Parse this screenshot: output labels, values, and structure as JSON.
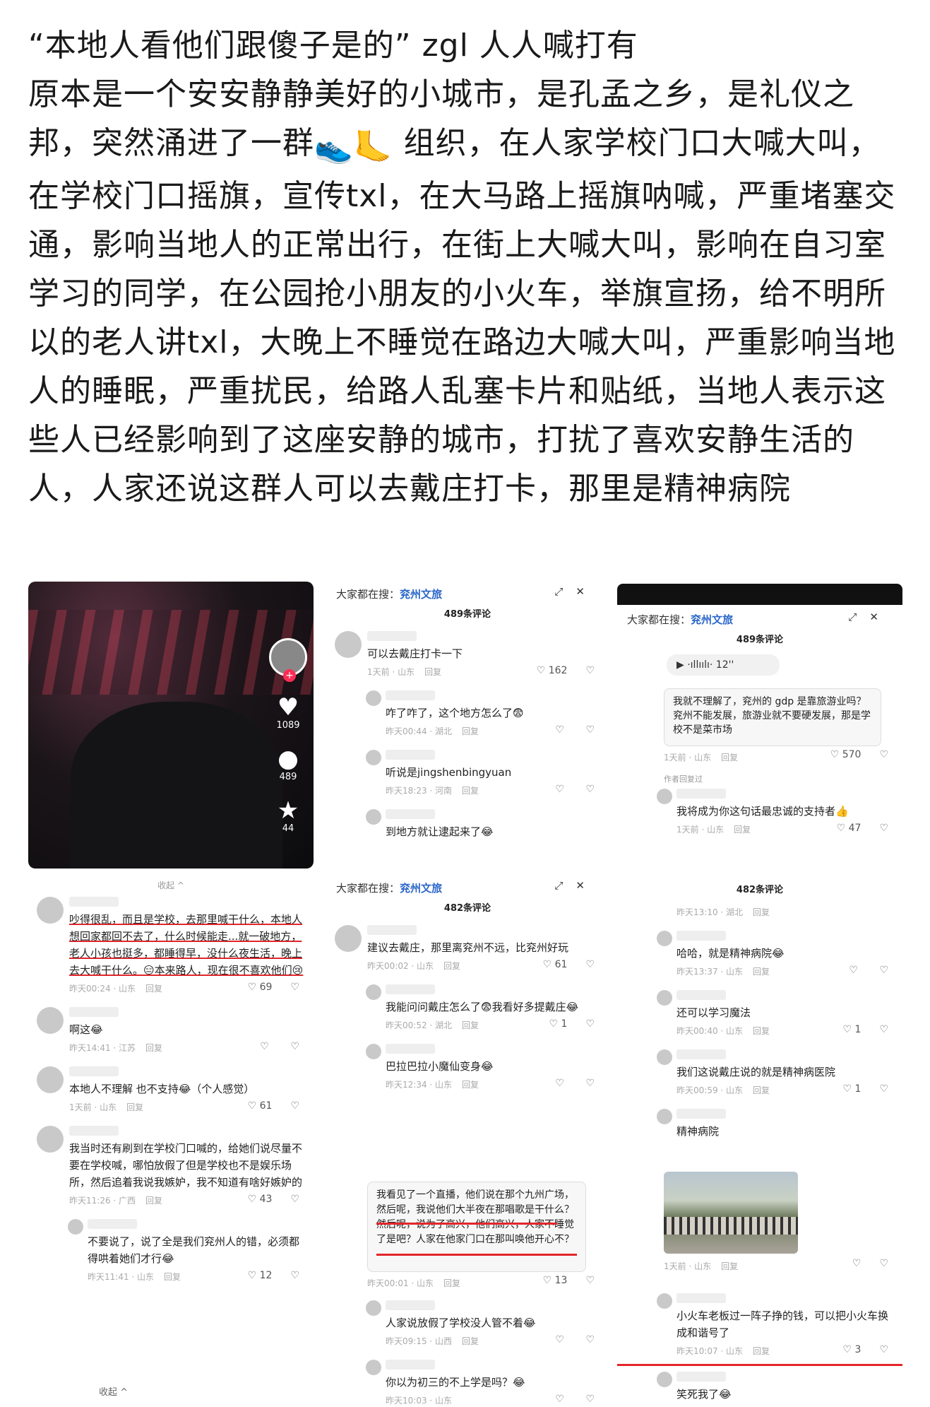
{
  "post": {
    "text": "“本地人看他们跟傻子是的” zgl 人人喊打有\n原本是一个安安静静美好的小城市，是孔孟之乡，是礼仪之邦，突然涌进了一群",
    "emoji_1": "👟",
    "emoji_2": "🦶",
    "text_2": "组织，在人家学校门口大喊大叫，在学校门口摇旗，宣传txl，在大马路上摇旗呐喊，严重堵塞交通，影响当地人的正常出行，在街上大喊大叫，影响在自习室学习的同学，在公园抢小朋友的小火车，举旗宣扬，给不明所以的老人讲txl，大晚上不睡觉在路边大喊大叫，严重影响当地人的睡眠，严重扰民，给路人乱塞卡片和贴纸，当地人表示这些人已经影响到了这座安静的城市，打扰了喜欢安静生活的人，人家还说这群人可以去戴庄打卡，那里是精神病院"
  },
  "video": {
    "likes": "1089",
    "comments": "489",
    "favorites": "44"
  },
  "search_header": {
    "prefix": "大家都在搜：",
    "query": "兖州文旅",
    "expand_icon": "expand-icon",
    "close_icon": "close-icon"
  },
  "panel_b": {
    "count": "489条评论",
    "comments": [
      {
        "text": "可以去戴庄打卡一下",
        "time": "1天前 · 山东",
        "reply": "回复",
        "likes": "162",
        "sub": false
      },
      {
        "text": "咋了咋了，这个地方怎么了😨",
        "time": "昨天00:44 · 湖北",
        "reply": "回复",
        "likes": "",
        "sub": true
      },
      {
        "text": "听说是jingshenbingyuan",
        "time": "昨天18:23 · 河南",
        "reply": "回复",
        "likes": "",
        "sub": true
      },
      {
        "text": "到地方就让逮起来了😂",
        "time": "",
        "reply": "",
        "likes": "",
        "sub": true
      }
    ]
  },
  "panel_c": {
    "count": "489条评论",
    "voice": "12''",
    "bubble": "我就不理解了，兖州的 gdp 是靠旅游业吗？兖州不能发展，旅游业就不要硬发展，那是学校不是菜市场",
    "bubble_time": "1天前 · 山东",
    "bubble_reply": "回复",
    "bubble_likes": "570",
    "author_tag": "作者回复过",
    "comments": [
      {
        "text": "我将成为你这句话最忠诚的支持者👍",
        "time": "1天前 · 山东",
        "reply": "回复",
        "likes": "47",
        "sub": true
      }
    ]
  },
  "panel_d": {
    "collapse": "收起 ^",
    "comments": [
      {
        "text": "吵得很乱，而且是学校，去那里喊干什么，本地人想回家都回不去了，什么时候能走...就一破地方，老人小孩也挺多，都睡得早，没什么夜生活，晚上去大喊干什么。😑本来路人，现在很不喜欢他们😢",
        "time": "昨天00:24 · 山东",
        "reply": "回复",
        "likes": "69",
        "sub": false
      },
      {
        "text": "啊这😂",
        "time": "昨天14:41 · 江苏",
        "reply": "回复",
        "likes": "",
        "sub": false
      },
      {
        "text": "本地人不理解  也不支持😂（个人感觉）",
        "time": "1天前 · 山东",
        "reply": "回复",
        "likes": "61",
        "sub": false
      },
      {
        "text": "我当时还有刷到在学校门口喊的，给她们说尽量不要在学校喊，哪怕放假了但是学校也不是娱乐场所，然后追着我说我嫉妒，我不知道有啥好嫉妒的",
        "time": "昨天11:26 · 广西",
        "reply": "回复",
        "likes": "43",
        "sub": false
      },
      {
        "text": "不要说了，说了全是我们兖州人的错，必须都得哄着她们才行😂",
        "time": "昨天11:41 · 山东",
        "reply": "回复",
        "likes": "12",
        "sub": true
      }
    ],
    "footer": "收起 ^"
  },
  "panel_e": {
    "count": "482条评论",
    "comments": [
      {
        "text": "建议去戴庄，那里离兖州不远，比兖州好玩",
        "time": "昨天00:02 · 山东",
        "reply": "回复",
        "likes": "61",
        "sub": false
      },
      {
        "text": "我能问问戴庄怎么了😨我看好多提戴庄😂",
        "time": "昨天00:52 · 湖北",
        "reply": "回复",
        "likes": "1",
        "sub": true
      },
      {
        "text": "巴拉巴拉小魔仙变身😂",
        "time": "昨天12:34 · 山东",
        "reply": "回复",
        "likes": "",
        "sub": true
      }
    ],
    "bubble": "我看见了一个直播，他们说在那个九州广场，然后呢，我说他们大半夜在那唱歌是干什么？然后呢，说为了高兴，他们高兴，人家不睡觉了是吧？人家在他家门口在那叫唤他开心不？",
    "bubble_time": "昨天00:01 · 山东",
    "bubble_reply": "回复",
    "bubble_likes": "13",
    "sub_comments": [
      {
        "text": "人家说放假了学校没人管不着😂",
        "time": "昨天09:15 · 山西",
        "reply": "回复",
        "likes": ""
      },
      {
        "text": "你以为初三的不上学是吗？😂",
        "time": "昨天10:03 · 山东",
        "reply": "",
        "likes": ""
      }
    ]
  },
  "panel_f": {
    "count": "482条评论",
    "top_meta": "昨天13:10 · 湖北",
    "top_reply": "回复",
    "comments": [
      {
        "text": "哈哈，就是精神病院😂",
        "time": "昨天13:37 · 山东",
        "reply": "回复",
        "likes": "",
        "sub": true
      },
      {
        "text": "还可以学习魔法",
        "time": "昨天00:40 · 山东",
        "reply": "回复",
        "likes": "1",
        "sub": true
      },
      {
        "text": "我们这说戴庄说的就是精神病医院",
        "time": "昨天00:59 · 山东",
        "reply": "回复",
        "likes": "1",
        "sub": true
      },
      {
        "text": "精神病院",
        "time": "",
        "reply": "",
        "likes": "",
        "sub": true
      }
    ],
    "photo_time": "1天前 · 山东",
    "photo_reply": "回复",
    "sub_comments": [
      {
        "text": "小火车老板过一阵子挣的钱，可以把小火车换成和谐号了",
        "time": "昨天10:07 · 山东",
        "reply": "回复",
        "likes": "3"
      },
      {
        "text": "笑死我了😂",
        "time": "",
        "reply": "",
        "likes": ""
      }
    ]
  }
}
